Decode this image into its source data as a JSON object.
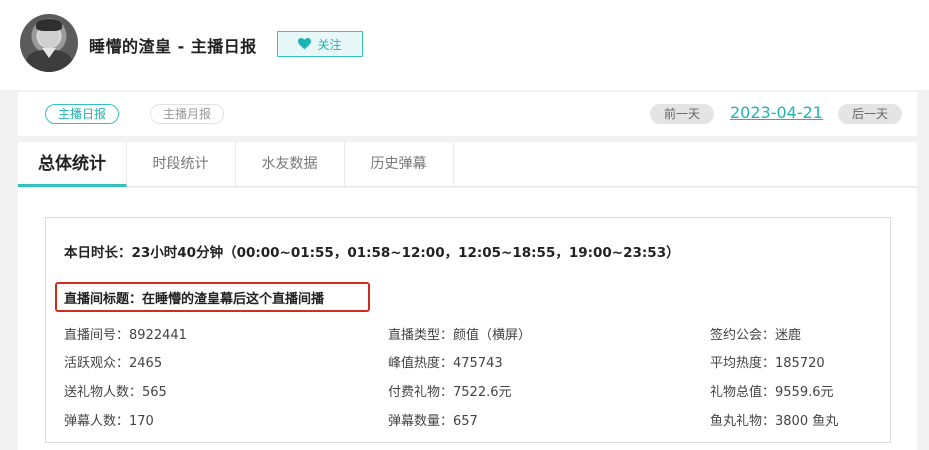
{
  "header": {
    "title": "睡懵的渣皇 - 主播日报",
    "follow_label": "关注",
    "accent_color": "#35c0c0"
  },
  "report_bar": {
    "daily_label": "主播日报",
    "monthly_label": "主播月报",
    "prev_label": "前一天",
    "date": "2023-04-21",
    "next_label": "后一天"
  },
  "tabs": [
    {
      "label": "总体统计",
      "active": true
    },
    {
      "label": "时段统计",
      "active": false
    },
    {
      "label": "水友数据",
      "active": false
    },
    {
      "label": "历史弹幕",
      "active": false
    }
  ],
  "summary": {
    "duration": "本日时长：23小时40分钟（00:00~01:55，01:58~12:00，12:05~18:55，19:00~23:53）",
    "room_title": "直播间标题：在睡懵的渣皇幕后这个直播间播",
    "highlight_color": "#d42a1f"
  },
  "stats": [
    [
      "直播间号：8922441",
      "直播类型：颜值（横屏）",
      "签约公会：迷鹿"
    ],
    [
      "活跃观众：2465",
      "峰值热度：475743",
      "平均热度：185720"
    ],
    [
      "送礼物人数：565",
      "付费礼物：7522.6元",
      "礼物总值：9559.6元"
    ],
    [
      "弹幕人数：170",
      "弹幕数量：657",
      "鱼丸礼物：3800 鱼丸"
    ]
  ]
}
